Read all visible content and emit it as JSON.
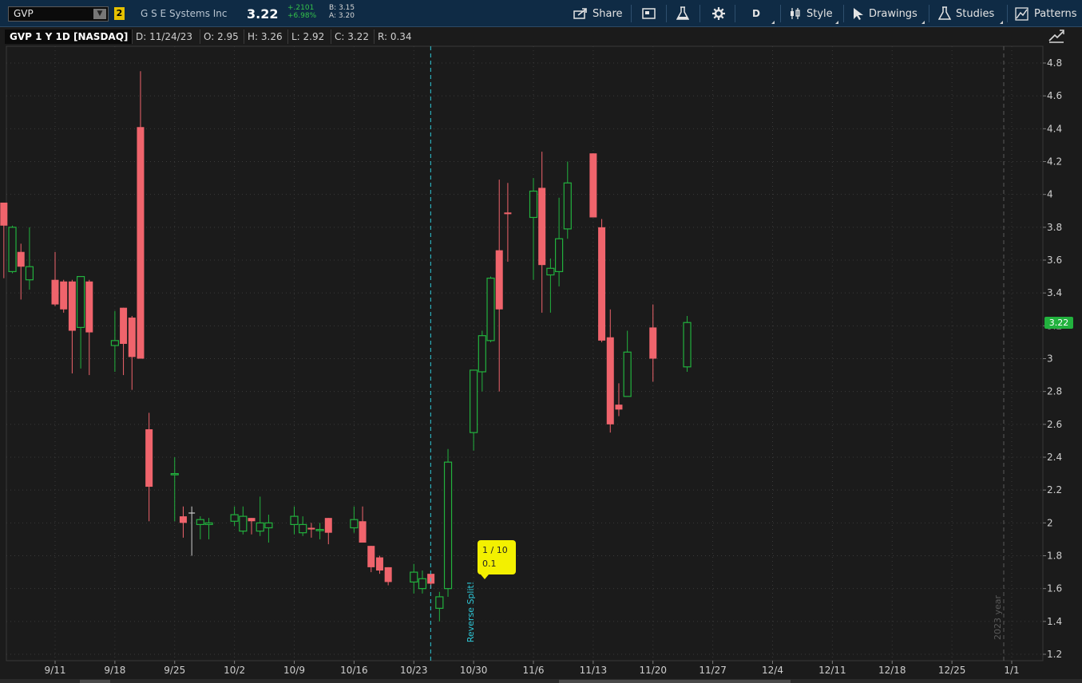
{
  "toolbar": {
    "symbol": "GVP",
    "link_number": "2",
    "company": "G S E Systems Inc",
    "last_price": "3.22",
    "net_change": "+.2101",
    "pct_change": "+6.98%",
    "bid": "B: 3.15",
    "ask": "A: 3.20",
    "share_label": "Share",
    "aggregation_label": "D",
    "style_label": "Style",
    "drawings_label": "Drawings",
    "studies_label": "Studies",
    "patterns_label": "Patterns"
  },
  "infobar": {
    "title": "GVP 1 Y 1D [NASDAQ]",
    "date": "D: 11/24/23",
    "open": "O: 2.95",
    "high": "H: 3.26",
    "low": "L: 2.92",
    "close": "C: 3.22",
    "range": "R: 0.34"
  },
  "colors": {
    "up": "#22b23e",
    "down": "#f0646c",
    "grid": "#3a3a3a",
    "split_line": "#2ec8d8",
    "bubble": "#f3f000",
    "toolbar_bg": "#0f2b45"
  },
  "annotations": {
    "split_ratio": "1 / 10",
    "split_value": "0.1",
    "split_label": "Reverse Split!",
    "year_marker": "2023 year",
    "current_price_tag": "3.22"
  },
  "chart_data": {
    "type": "candlestick",
    "title": "",
    "y_ticks": [
      "1.2",
      "1.4",
      "1.6",
      "1.8",
      "2",
      "2.2",
      "2.4",
      "2.6",
      "2.8",
      "3",
      "3.2",
      "3.4",
      "3.6",
      "3.8",
      "4",
      "4.2",
      "4.4",
      "4.6",
      "4.8"
    ],
    "ylim": [
      1.2,
      4.8
    ],
    "x_ticks": [
      "9/11",
      "9/18",
      "9/25",
      "10/2",
      "10/9",
      "10/16",
      "10/23",
      "10/30",
      "11/6",
      "11/13",
      "11/20",
      "11/27",
      "12/4",
      "12/11",
      "12/18",
      "12/25",
      "1/1"
    ],
    "grid": true,
    "candles": [
      {
        "date": "9/5",
        "o": 3.95,
        "h": 3.95,
        "l": 3.49,
        "c": 3.81
      },
      {
        "date": "9/6",
        "o": 3.53,
        "h": 3.81,
        "l": 3.52,
        "c": 3.8
      },
      {
        "date": "9/7",
        "o": 3.65,
        "h": 3.7,
        "l": 3.36,
        "c": 3.56
      },
      {
        "date": "9/8",
        "o": 3.48,
        "h": 3.8,
        "l": 3.42,
        "c": 3.56
      },
      {
        "date": "9/11",
        "o": 3.48,
        "h": 3.65,
        "l": 3.32,
        "c": 3.33
      },
      {
        "date": "9/12",
        "o": 3.47,
        "h": 3.48,
        "l": 3.28,
        "c": 3.3
      },
      {
        "date": "9/13",
        "o": 3.47,
        "h": 3.48,
        "l": 2.91,
        "c": 3.17
      },
      {
        "date": "9/14",
        "o": 3.19,
        "h": 3.5,
        "l": 2.94,
        "c": 3.5
      },
      {
        "date": "9/15",
        "o": 3.47,
        "h": 3.48,
        "l": 2.9,
        "c": 3.16
      },
      {
        "date": "9/18",
        "o": 3.08,
        "h": 3.29,
        "l": 2.92,
        "c": 3.11
      },
      {
        "date": "9/19",
        "o": 3.31,
        "h": 3.31,
        "l": 2.9,
        "c": 3.09
      },
      {
        "date": "9/20",
        "o": 3.25,
        "h": 3.26,
        "l": 2.81,
        "c": 3.01
      },
      {
        "date": "9/21",
        "o": 4.41,
        "h": 4.75,
        "l": 3.0,
        "c": 3.0
      },
      {
        "date": "9/22",
        "o": 2.57,
        "h": 2.67,
        "l": 2.01,
        "c": 2.22
      },
      {
        "date": "9/25",
        "o": 2.3,
        "h": 2.4,
        "l": 2.01,
        "c": 2.3
      },
      {
        "date": "9/26",
        "o": 2.04,
        "h": 2.1,
        "l": 1.91,
        "c": 2.0
      },
      {
        "date": "9/27",
        "o": 2.06,
        "h": 2.1,
        "l": 1.8,
        "c": 2.06
      },
      {
        "date": "9/28",
        "o": 1.99,
        "h": 2.04,
        "l": 1.9,
        "c": 2.02
      },
      {
        "date": "9/29",
        "o": 1.99,
        "h": 2.03,
        "l": 1.9,
        "c": 2.0
      },
      {
        "date": "10/2",
        "o": 2.01,
        "h": 2.1,
        "l": 1.98,
        "c": 2.05
      },
      {
        "date": "10/3",
        "o": 1.95,
        "h": 2.1,
        "l": 1.93,
        "c": 2.04
      },
      {
        "date": "10/4",
        "o": 2.03,
        "h": 2.03,
        "l": 1.93,
        "c": 2.01
      },
      {
        "date": "10/5",
        "o": 1.95,
        "h": 2.16,
        "l": 1.92,
        "c": 2.0
      },
      {
        "date": "10/6",
        "o": 1.97,
        "h": 2.05,
        "l": 1.88,
        "c": 2.0
      },
      {
        "date": "10/9",
        "o": 1.99,
        "h": 2.1,
        "l": 1.93,
        "c": 2.04
      },
      {
        "date": "10/10",
        "o": 1.94,
        "h": 2.04,
        "l": 1.92,
        "c": 1.99
      },
      {
        "date": "10/11",
        "o": 1.97,
        "h": 2.0,
        "l": 1.91,
        "c": 1.96
      },
      {
        "date": "10/12",
        "o": 1.96,
        "h": 2.0,
        "l": 1.9,
        "c": 1.96
      },
      {
        "date": "10/13",
        "o": 2.03,
        "h": 2.03,
        "l": 1.87,
        "c": 1.94
      },
      {
        "date": "10/16",
        "o": 1.97,
        "h": 2.1,
        "l": 1.94,
        "c": 2.02
      },
      {
        "date": "10/17",
        "o": 2.01,
        "h": 2.1,
        "l": 1.88,
        "c": 1.88
      },
      {
        "date": "10/18",
        "o": 1.86,
        "h": 1.86,
        "l": 1.7,
        "c": 1.73
      },
      {
        "date": "10/19",
        "o": 1.79,
        "h": 1.8,
        "l": 1.69,
        "c": 1.71
      },
      {
        "date": "10/20",
        "o": 1.73,
        "h": 1.73,
        "l": 1.62,
        "c": 1.64
      },
      {
        "date": "10/23",
        "o": 1.64,
        "h": 1.75,
        "l": 1.57,
        "c": 1.7
      },
      {
        "date": "10/24",
        "o": 1.6,
        "h": 1.71,
        "l": 1.57,
        "c": 1.66
      },
      {
        "date": "10/25",
        "o": 1.69,
        "h": 1.69,
        "l": 1.6,
        "c": 1.63
      },
      {
        "date": "10/26",
        "o": 1.48,
        "h": 1.58,
        "l": 1.4,
        "c": 1.55
      },
      {
        "date": "10/27",
        "o": 1.6,
        "h": 2.45,
        "l": 1.55,
        "c": 2.37
      },
      {
        "date": "10/30",
        "o": 2.55,
        "h": 2.93,
        "l": 2.44,
        "c": 2.93
      },
      {
        "date": "10/31",
        "o": 2.92,
        "h": 3.17,
        "l": 2.8,
        "c": 3.14
      },
      {
        "date": "11/1",
        "o": 3.11,
        "h": 3.5,
        "l": 3.1,
        "c": 3.49
      },
      {
        "date": "11/2",
        "o": 3.66,
        "h": 4.09,
        "l": 2.8,
        "c": 3.3
      },
      {
        "date": "11/3",
        "o": 3.89,
        "h": 4.07,
        "l": 3.59,
        "c": 3.88
      },
      {
        "date": "11/6",
        "o": 3.86,
        "h": 4.1,
        "l": 3.48,
        "c": 4.02
      },
      {
        "date": "11/7",
        "o": 4.04,
        "h": 4.26,
        "l": 3.28,
        "c": 3.57
      },
      {
        "date": "11/8",
        "o": 3.51,
        "h": 3.61,
        "l": 3.28,
        "c": 3.55
      },
      {
        "date": "11/9",
        "o": 3.53,
        "h": 3.98,
        "l": 3.44,
        "c": 3.73
      },
      {
        "date": "11/10",
        "o": 3.79,
        "h": 4.2,
        "l": 3.73,
        "c": 4.07
      },
      {
        "date": "11/13",
        "o": 4.25,
        "h": 4.25,
        "l": 3.86,
        "c": 3.86
      },
      {
        "date": "11/14",
        "o": 3.8,
        "h": 3.85,
        "l": 3.1,
        "c": 3.11
      },
      {
        "date": "11/15",
        "o": 3.13,
        "h": 3.3,
        "l": 2.55,
        "c": 2.6
      },
      {
        "date": "11/16",
        "o": 2.72,
        "h": 2.85,
        "l": 2.65,
        "c": 2.69
      },
      {
        "date": "11/17",
        "o": 2.77,
        "h": 3.17,
        "l": 2.77,
        "c": 3.04
      },
      {
        "date": "11/20",
        "o": 3.19,
        "h": 3.33,
        "l": 2.86,
        "c": 3.0
      },
      {
        "date": "11/24",
        "o": 2.95,
        "h": 3.26,
        "l": 2.92,
        "c": 3.22
      }
    ]
  }
}
